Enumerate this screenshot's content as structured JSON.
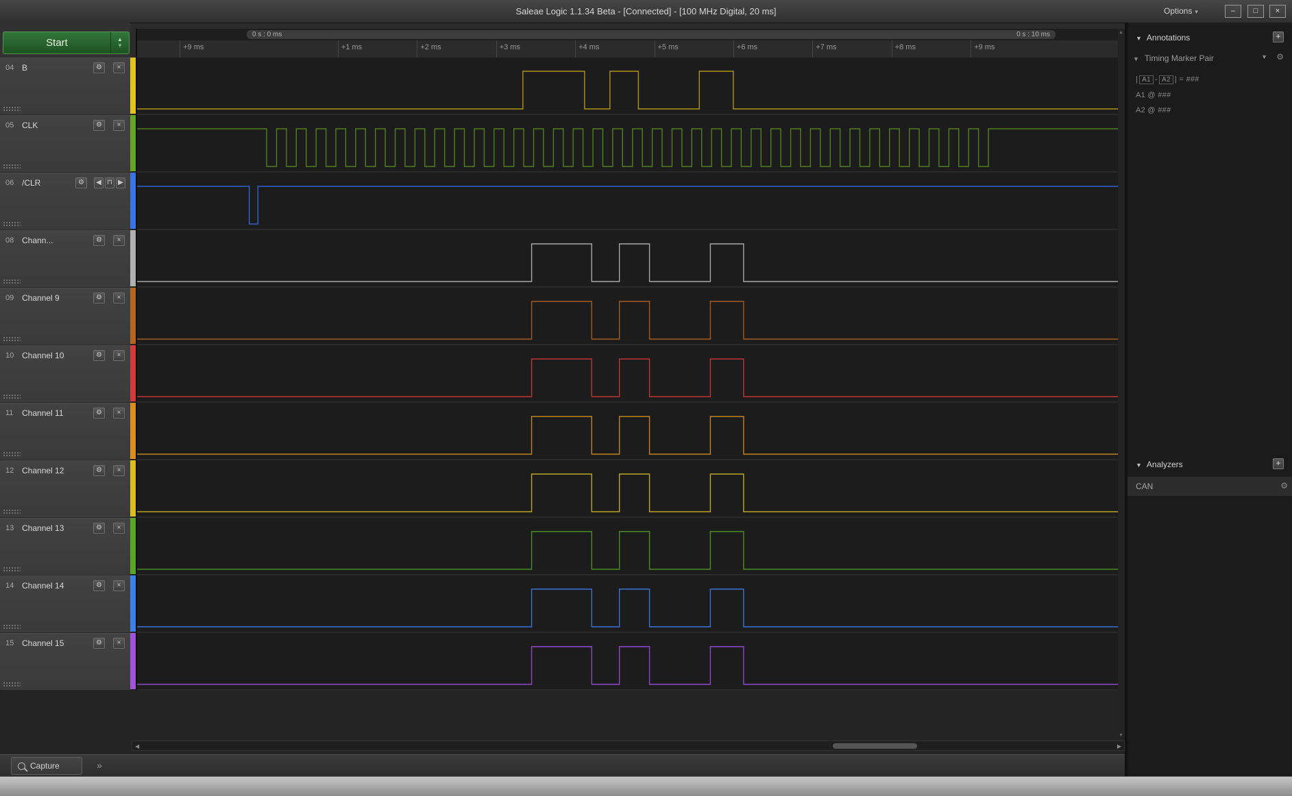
{
  "window": {
    "title": "Saleae Logic 1.1.34 Beta - [Connected] - [100 MHz Digital, 20 ms]",
    "options_label": "Options",
    "minimize_glyph": "–",
    "maximize_glyph": "□",
    "close_glyph": "×"
  },
  "glyphs": {
    "gear": "⚙",
    "close": "×",
    "plus": "+",
    "collapse": "▼",
    "caret": "▾",
    "up": "▲",
    "down": "▼",
    "left": "◀",
    "right": "▶",
    "pulse": "⊓",
    "more": "»",
    "scroll_left": "◀",
    "scroll_right": "▶"
  },
  "toolbar": {
    "start_label": "Start"
  },
  "timeline": {
    "extent_start_label": "0 s : 0 ms",
    "extent_end_label": "0 s : 10 ms",
    "ticks": [
      {
        "t": -1,
        "label": "+9 ms"
      },
      {
        "t": 1,
        "label": "+1 ms"
      },
      {
        "t": 2,
        "label": "+2 ms"
      },
      {
        "t": 3,
        "label": "+3 ms"
      },
      {
        "t": 4,
        "label": "+4 ms"
      },
      {
        "t": 5,
        "label": "+5 ms"
      },
      {
        "t": 6,
        "label": "+6 ms"
      },
      {
        "t": 7,
        "label": "+7 ms"
      },
      {
        "t": 8,
        "label": "+8 ms"
      },
      {
        "t": 9,
        "label": "+9 ms"
      }
    ]
  },
  "channels": [
    {
      "num": "04",
      "name": "B",
      "color": "#b09212",
      "strip": "#e0c31c",
      "controls": "standard",
      "pattern": {
        "baseline": "low",
        "highs": [
          [
            3.34,
            4.12
          ],
          [
            4.44,
            4.8
          ],
          [
            5.57,
            6.0
          ]
        ]
      }
    },
    {
      "num": "05",
      "name": "CLK",
      "color": "#527f20",
      "strip": "#66a428",
      "controls": "standard",
      "pattern": {
        "baseline": "high",
        "clock": {
          "start": 0.1,
          "period": 0.25,
          "cycles": 37
        }
      }
    },
    {
      "num": "06",
      "name": "/CLR",
      "color": "#2f63cf",
      "strip": "#3a73e8",
      "controls": "trigger",
      "pattern": {
        "baseline": "high",
        "lows": [
          [
            -0.12,
            -0.01
          ]
        ]
      }
    },
    {
      "num": "08",
      "name": "Chann...",
      "color": "#a8a8a8",
      "strip": "#b0b0b0",
      "controls": "standard",
      "pattern": {
        "baseline": "low",
        "highs": [
          [
            3.45,
            4.21
          ],
          [
            4.56,
            4.94
          ],
          [
            5.71,
            6.13
          ]
        ]
      }
    },
    {
      "num": "09",
      "name": "Channel 9",
      "color": "#a55a1f",
      "strip": "#b4661f",
      "controls": "standard",
      "pattern": {
        "baseline": "low",
        "highs": [
          [
            3.45,
            4.21
          ],
          [
            4.56,
            4.94
          ],
          [
            5.71,
            6.13
          ]
        ]
      }
    },
    {
      "num": "10",
      "name": "Channel 10",
      "color": "#c13434",
      "strip": "#d23b3b",
      "controls": "standard",
      "pattern": {
        "baseline": "low",
        "highs": [
          [
            3.45,
            4.21
          ],
          [
            4.56,
            4.94
          ],
          [
            5.71,
            6.13
          ]
        ]
      }
    },
    {
      "num": "11",
      "name": "Channel 11",
      "color": "#c4831d",
      "strip": "#d98f1e",
      "controls": "standard",
      "pattern": {
        "baseline": "low",
        "highs": [
          [
            3.45,
            4.21
          ],
          [
            4.56,
            4.94
          ],
          [
            5.71,
            6.13
          ]
        ]
      }
    },
    {
      "num": "12",
      "name": "Channel 12",
      "color": "#bfa71c",
      "strip": "#d9bd1e",
      "controls": "standard",
      "pattern": {
        "baseline": "low",
        "highs": [
          [
            3.45,
            4.21
          ],
          [
            4.56,
            4.94
          ],
          [
            5.71,
            6.13
          ]
        ]
      }
    },
    {
      "num": "13",
      "name": "Channel 13",
      "color": "#4c8d22",
      "strip": "#5aa727",
      "controls": "standard",
      "pattern": {
        "baseline": "low",
        "highs": [
          [
            3.45,
            4.21
          ],
          [
            4.56,
            4.94
          ],
          [
            5.71,
            6.13
          ]
        ]
      }
    },
    {
      "num": "14",
      "name": "Channel 14",
      "color": "#3a72d8",
      "strip": "#3f7fe8",
      "controls": "standard",
      "pattern": {
        "baseline": "low",
        "highs": [
          [
            3.45,
            4.21
          ],
          [
            4.56,
            4.94
          ],
          [
            5.71,
            6.13
          ]
        ]
      }
    },
    {
      "num": "15",
      "name": "Channel 15",
      "color": "#9046cc",
      "strip": "#9f54da",
      "controls": "standard",
      "pattern": {
        "baseline": "low",
        "highs": [
          [
            3.45,
            4.21
          ],
          [
            4.56,
            4.94
          ],
          [
            5.71,
            6.13
          ]
        ]
      }
    }
  ],
  "right_panel": {
    "annotations_title": "Annotations",
    "timing_marker": {
      "title": "Timing Marker Pair",
      "delta_open": "|",
      "a1": "A1",
      "dash": "-",
      "a2": "A2",
      "delta_close": "|",
      "eq": "=",
      "value": "###",
      "lines": [
        {
          "label": "A1",
          "at": "@",
          "value": "###"
        },
        {
          "label": "A2",
          "at": "@",
          "value": "###"
        }
      ]
    },
    "analyzers_title": "Analyzers",
    "analyzers": [
      {
        "name": "CAN"
      }
    ]
  },
  "bottom_bar": {
    "capture_tab_label": "Capture"
  }
}
